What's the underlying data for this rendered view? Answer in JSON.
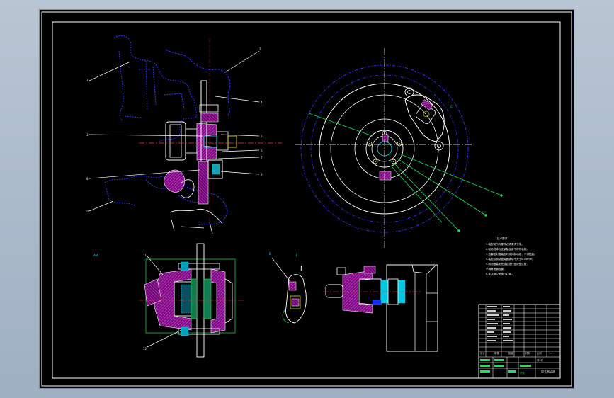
{
  "drawing": {
    "colors": {
      "sheet": "#000000",
      "frame": "#ffffff",
      "outline": "#ffffff",
      "chassis": "#2a3cff",
      "hatch": "#c020c0",
      "leader": "#22dd55",
      "center": "#ff3030",
      "cyan": "#00d8ff",
      "yellow": "#ffee00"
    },
    "icons": {
      "part_number_marker": "circle-dot-icon",
      "section_marker": "arrow-icon"
    },
    "main_labels": {
      "part_1": "1",
      "part_2": "2",
      "part_3": "3",
      "part_4": "4",
      "part_5": "5",
      "part_6": "6",
      "part_7": "7",
      "part_8": "8",
      "part_9": "9",
      "part_10": "10",
      "part_11": "11",
      "part_12": "12"
    },
    "view_labels": {
      "section_a": "A-A",
      "section_b": "B",
      "detail_i": "I",
      "detail_label": "I",
      "section_left": "B-B",
      "view_c": "C"
    },
    "tech_notes": {
      "title": "技术要求",
      "line_1": "1.装配前所有零件必须清洗干净。",
      "line_2": "2.制动钳体与支架配合面不得有毛刺。",
      "line_3": "3.活塞密封圈装配时涂抹制动液，不得扭曲。",
      "line_4": "4.装配后制动盘端面跳动不大于0.05mm。",
      "line_5": "5.制动器装配完成后进行密封性试验，",
      "line_6": "不得有泄漏现象。",
      "line_7": "6.未注明公差按IT12级。"
    },
    "title_block": {
      "drawing_name": "盘式制动器",
      "scale_label": "比例",
      "scale_value": "1:1",
      "sheet_label": "共1张",
      "material_label": "材料",
      "designer_label": "设计",
      "checker_label": "审核",
      "approver_label": "批准",
      "school_label": "学院"
    }
  }
}
